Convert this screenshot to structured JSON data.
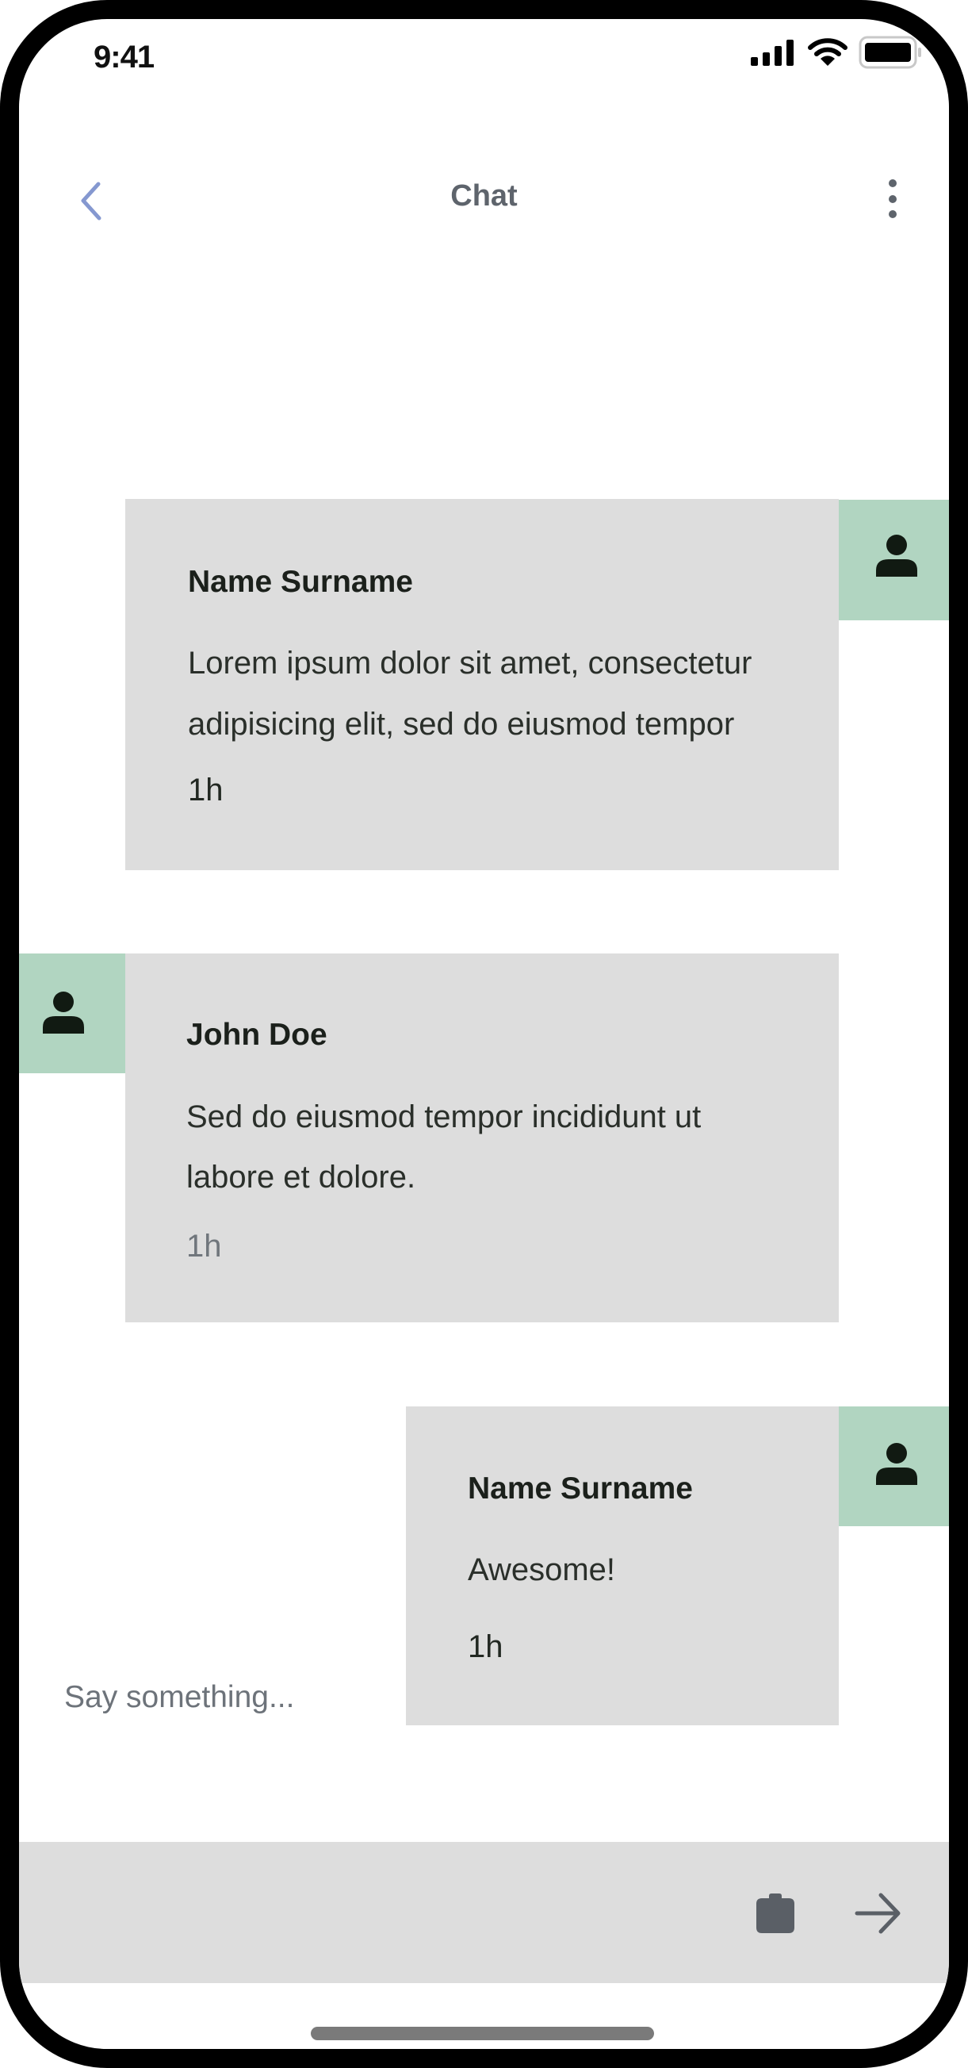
{
  "status_bar": {
    "time": "9:41",
    "icons": [
      "cellular-signal-icon",
      "wifi-icon",
      "battery-icon"
    ]
  },
  "nav": {
    "back_icon": "chevron-left-icon",
    "title": "Chat",
    "menu_icon": "more-vertical-icon"
  },
  "messages": [
    {
      "sender": "Name Surname",
      "side": "right",
      "avatar_icon": "person-icon",
      "lines": [
        "Lorem ipsum dolor sit amet, consectetur",
        "adipisicing elit, sed do eiusmod tempor"
      ],
      "time": "1h"
    },
    {
      "sender": "John Doe",
      "side": "left",
      "avatar_icon": "person-icon",
      "lines": [
        "Sed do eiusmod tempor incididunt ut",
        "labore et dolore."
      ],
      "time": "1h"
    },
    {
      "sender": "Name Surname",
      "side": "right",
      "avatar_icon": "person-icon",
      "lines": [
        "Awesome!"
      ],
      "time": "1h"
    }
  ],
  "composer": {
    "placeholder": "Say something...",
    "attach_icon": "camera-icon",
    "send_icon": "arrow-right-icon"
  },
  "colors": {
    "bubble": "#dddddd",
    "avatar": "#b1d5c1",
    "accent": "#8598d0"
  }
}
